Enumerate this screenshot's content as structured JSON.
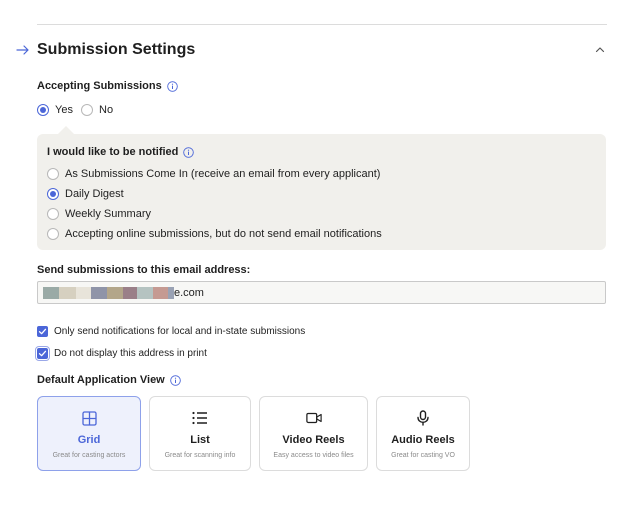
{
  "section": {
    "title": "Submission Settings"
  },
  "accepting": {
    "label": "Accepting Submissions",
    "options": [
      {
        "label": "Yes",
        "selected": true
      },
      {
        "label": "No",
        "selected": false
      }
    ]
  },
  "notify": {
    "label": "I would like to be notified",
    "options": [
      {
        "label": "As Submissions Come In (receive an email from every applicant)",
        "selected": false
      },
      {
        "label": "Daily Digest",
        "selected": true
      },
      {
        "label": "Weekly Summary",
        "selected": false
      },
      {
        "label": "Accepting online submissions, but do not send email notifications",
        "selected": false
      }
    ]
  },
  "email": {
    "label": "Send submissions to this email address:",
    "value_suffix": "e.com"
  },
  "checks": [
    {
      "label": "Only send notifications for local and in-state submissions",
      "checked": true
    },
    {
      "label": "Do not display this address in print",
      "checked": true
    }
  ],
  "view": {
    "label": "Default Application View",
    "cards": [
      {
        "title": "Grid",
        "sub": "Great for casting actors",
        "selected": true,
        "icon": "grid-icon"
      },
      {
        "title": "List",
        "sub": "Great for scanning info",
        "selected": false,
        "icon": "list-icon"
      },
      {
        "title": "Video Reels",
        "sub": "Easy access to video files",
        "selected": false,
        "icon": "video-icon"
      },
      {
        "title": "Audio Reels",
        "sub": "Great for casting VO",
        "selected": false,
        "icon": "microphone-icon"
      }
    ]
  },
  "colors": {
    "accent": "#4b66d8",
    "panel": "#f1f0ec"
  }
}
